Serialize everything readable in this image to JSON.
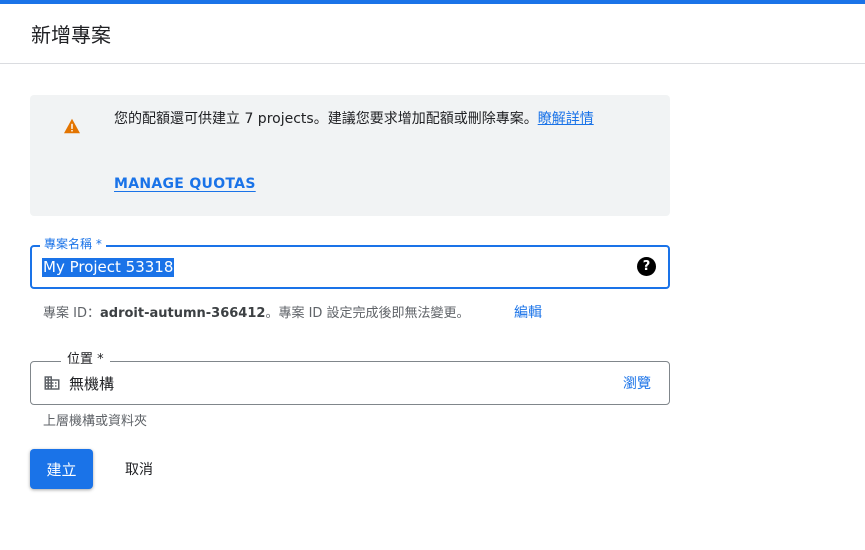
{
  "page": {
    "title": "新增專案",
    "accent_color": "#1a73e8"
  },
  "notice": {
    "icon": "warning-icon",
    "text": "您的配額還可供建立 7 projects。建議您要求增加配額或刪除專案。",
    "learn_more": "瞭解詳情",
    "manage_quotas": "MANAGE QUOTAS"
  },
  "project_name": {
    "label": "專案名稱 *",
    "value": "My Project 53318",
    "help_icon": "help-icon"
  },
  "project_id": {
    "prefix": "專案 ID：",
    "value": "adroit-autumn-366412",
    "suffix": "。專案 ID 設定完成後即無法變更。",
    "edit": "編輯"
  },
  "location": {
    "label": "位置 *",
    "icon": "organization-icon",
    "value": "無機構",
    "browse": "瀏覽",
    "hint": "上層機構或資料夾"
  },
  "actions": {
    "create": "建立",
    "cancel": "取消"
  }
}
